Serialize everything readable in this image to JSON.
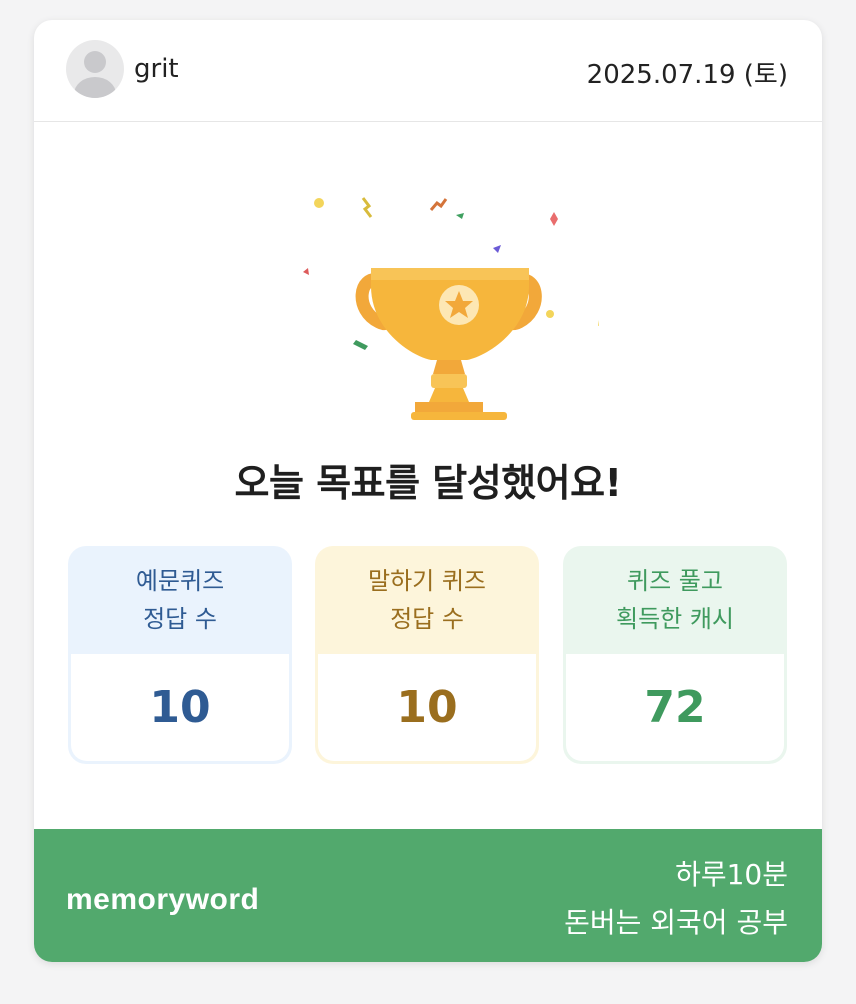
{
  "header": {
    "username": "grit",
    "date": "2025.07.19 (토)"
  },
  "main": {
    "title": "오늘 목표를 달성했어요!"
  },
  "stats": [
    {
      "label_line1": "예문퀴즈",
      "label_line2": "정답 수",
      "value": "10"
    },
    {
      "label_line1": "말하기 퀴즈",
      "label_line2": "정답 수",
      "value": "10"
    },
    {
      "label_line1": "퀴즈 풀고",
      "label_line2": "획득한 캐시",
      "value": "72"
    }
  ],
  "footer": {
    "brand": "memoryword",
    "slogan_line1": "하루10분",
    "slogan_line2": "돈버는 외국어 공부"
  },
  "colors": {
    "footer_bg": "#52a96d",
    "stat1_accent": "#2f5b93",
    "stat2_accent": "#9a6e1e",
    "stat3_accent": "#3f9a5e",
    "trophy": "#f6b63c"
  },
  "icons": {
    "avatar": "default-user-avatar-icon",
    "trophy": "trophy-star-icon",
    "confetti": "confetti-decoration"
  }
}
